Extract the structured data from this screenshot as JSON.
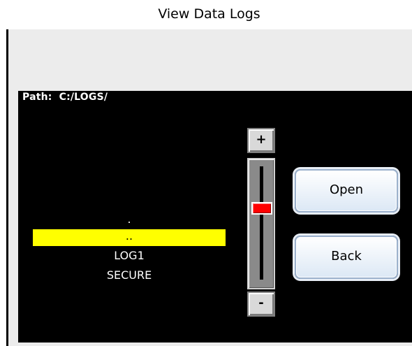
{
  "window": {
    "title": "View Data Logs"
  },
  "path": {
    "label": "Path:",
    "value": "C:/LOGS/"
  },
  "file_list": {
    "items": [
      {
        "label": ".",
        "selected": false
      },
      {
        "label": "..",
        "selected": true
      },
      {
        "label": "LOG1",
        "selected": false
      },
      {
        "label": "SECURE",
        "selected": false
      }
    ]
  },
  "scrollbar": {
    "up_label": "+",
    "down_label": "-",
    "position_fraction": 0.37
  },
  "buttons": {
    "open_label": "Open",
    "back_label": "Back"
  },
  "colors": {
    "selection": "#ffff00",
    "panel": "#000000",
    "thumb": "#ff0000"
  }
}
